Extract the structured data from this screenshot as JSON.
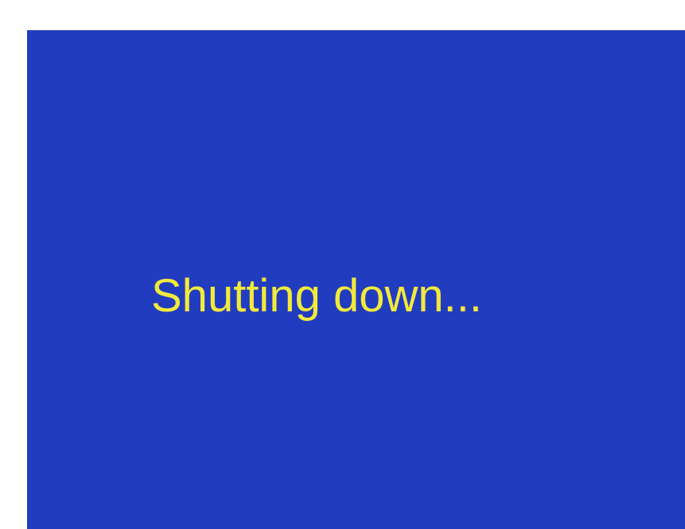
{
  "screen": {
    "message": "Shutting down...",
    "background_color": "#223cc0",
    "text_color": "#f2ea3a",
    "outer_background_color": "#ffffff"
  }
}
